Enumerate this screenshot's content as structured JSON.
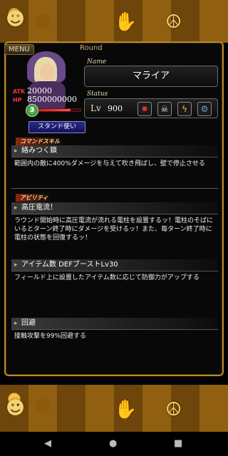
{
  "menu_label": "MENU",
  "round_label": "Round",
  "character": {
    "name_field_label": "Name",
    "name": "マライア",
    "atk_label": "ATK",
    "atk": "20000",
    "hp_label": "HP",
    "hp": "8500000000",
    "rank_badge": "3",
    "hp_fill": 0.75
  },
  "status": {
    "field_label": "Status",
    "lv_label": "Lv",
    "lv_value": "900",
    "icons": [
      "mark-icon",
      "skull-icon",
      "lightning-icon",
      "bolt-gear-icon"
    ]
  },
  "stand_button": "スタンド使い",
  "command_skill": {
    "tag": "コマンドスキル",
    "title": "絡みつく鎖",
    "description": "範囲内の敵に400%ダメージを与えて吹き飛ばし、壁で停止させる"
  },
  "ability_tag": "アビリティ",
  "abilities": [
    {
      "title": "高圧電流！",
      "description": "ラウンド開始時に高圧電流が流れる電柱を設置するッ！電柱のそばにいるとターン終了時にダメージを受けるッ！また、毎ターン終了時に電柱の状態を回復するッ！"
    },
    {
      "title": "アイテム数 DEFブーストLv30",
      "description": "フィールド上に設置したアイテム数に応じて防御力がアップする"
    },
    {
      "title": "回避",
      "description": "接触攻撃を99%回避する"
    }
  ],
  "nav": {
    "back": "◀",
    "home": "●",
    "recents": "■"
  }
}
